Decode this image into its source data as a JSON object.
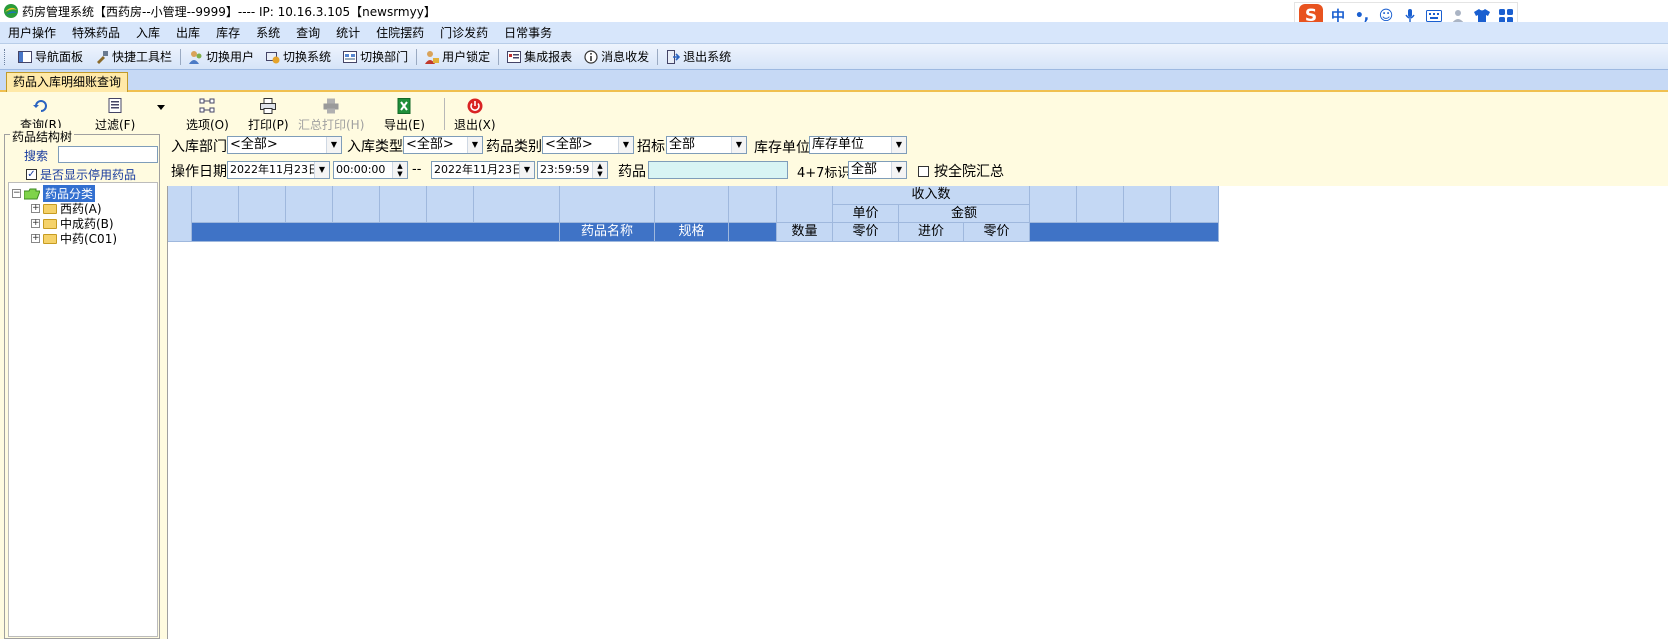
{
  "window": {
    "title": "药房管理系统【西药房--小管理--9999】---- IP: 10.16.3.105【newsrmyy】"
  },
  "ime": {
    "logo": "S",
    "mode": "中",
    "punct": "•,"
  },
  "menubar": [
    "用户操作",
    "特殊药品",
    "入库",
    "出库",
    "库存",
    "系统",
    "查询",
    "统计",
    "住院摆药",
    "门诊发药",
    "日常事务"
  ],
  "toolbar": [
    {
      "label": "导航面板",
      "icon": "navigation-panel-icon"
    },
    {
      "label": "快捷工具栏",
      "icon": "quick-toolbar-icon"
    },
    {
      "label": "切换用户",
      "icon": "switch-user-icon"
    },
    {
      "label": "切换系统",
      "icon": "switch-system-icon"
    },
    {
      "label": "切换部门",
      "icon": "switch-department-icon"
    },
    {
      "label": "用户锁定",
      "icon": "user-lock-icon"
    },
    {
      "label": "集成报表",
      "icon": "report-icon"
    },
    {
      "label": "消息收发",
      "icon": "message-icon"
    },
    {
      "label": "退出系统",
      "icon": "exit-system-icon"
    }
  ],
  "tab": {
    "label": "药品入库明细账查询"
  },
  "actions": {
    "query": "查询(R)",
    "filter": "过滤(F)",
    "options": "选项(O)",
    "print": "打印(P)",
    "summary_print": "汇总打印(H)",
    "export": "导出(E)",
    "exit": "退出(X)"
  },
  "tree_panel": {
    "legend": "药品结构树",
    "search_label": "搜索",
    "search_value": "",
    "show_stopped": "是否显示停用药品",
    "show_stopped_checked": true,
    "root": "药品分类",
    "nodes": [
      "西药(A)",
      "中成药(B)",
      "中药(C01)"
    ]
  },
  "filters": {
    "dept_label": "入库部门",
    "dept_value": "<全部>",
    "type_label": "入库类型",
    "type_value": "<全部>",
    "category_label": "药品类别",
    "category_value": "<全部>",
    "bid_label": "招标",
    "bid_value": "全部",
    "unit_label": "库存单位",
    "unit_value": "库存单位",
    "date_label": "操作日期",
    "date_from": "2022年11月23日",
    "time_from": "00:00:00",
    "range_sep": "--",
    "date_to": "2022年11月23日",
    "time_to": "23:59:59",
    "drug_label": "药品",
    "drug_value": "",
    "flag_label": "4+7标识",
    "flag_value": "全部",
    "hospital_summary": "按全院汇总"
  },
  "grid": {
    "group_title": "收入数",
    "unit_price": "单价",
    "amount": "金额",
    "drug_name": "药品名称",
    "spec": "规格",
    "quantity": "数量",
    "retail_price": "零价",
    "purchase_price": "进价",
    "retail_amount": "零价"
  }
}
